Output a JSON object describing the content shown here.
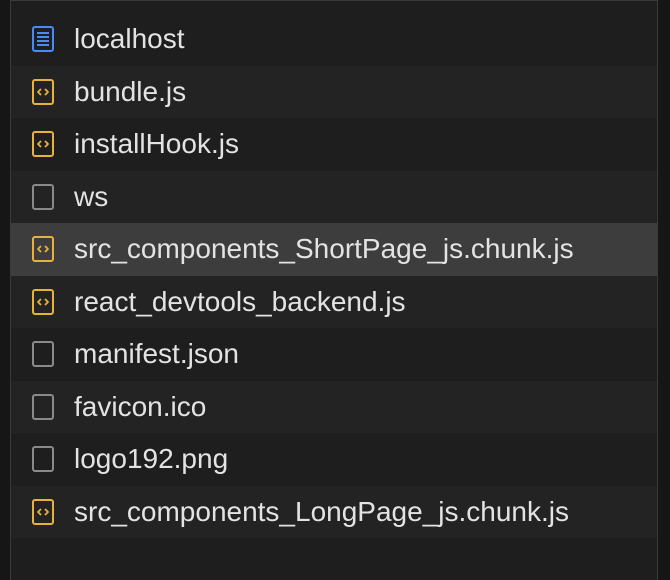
{
  "requests": {
    "selected_index": 4,
    "items": [
      {
        "name": "localhost",
        "icon": "document-icon"
      },
      {
        "name": "bundle.js",
        "icon": "script-icon"
      },
      {
        "name": "installHook.js",
        "icon": "script-icon"
      },
      {
        "name": "ws",
        "icon": "blank-file-icon"
      },
      {
        "name": "src_components_ShortPage_js.chunk.js",
        "icon": "script-icon"
      },
      {
        "name": "react_devtools_backend.js",
        "icon": "script-icon"
      },
      {
        "name": "manifest.json",
        "icon": "blank-file-icon"
      },
      {
        "name": "favicon.ico",
        "icon": "blank-file-icon"
      },
      {
        "name": "logo192.png",
        "icon": "blank-file-icon"
      },
      {
        "name": "src_components_LongPage_js.chunk.js",
        "icon": "script-icon"
      }
    ]
  },
  "colors": {
    "document_icon": "#4a8af4",
    "script_icon": "#e8b23a",
    "blank_icon": "#8a8a8a",
    "text": "#e3e3e3",
    "row_selected": "#3d3d3d"
  }
}
